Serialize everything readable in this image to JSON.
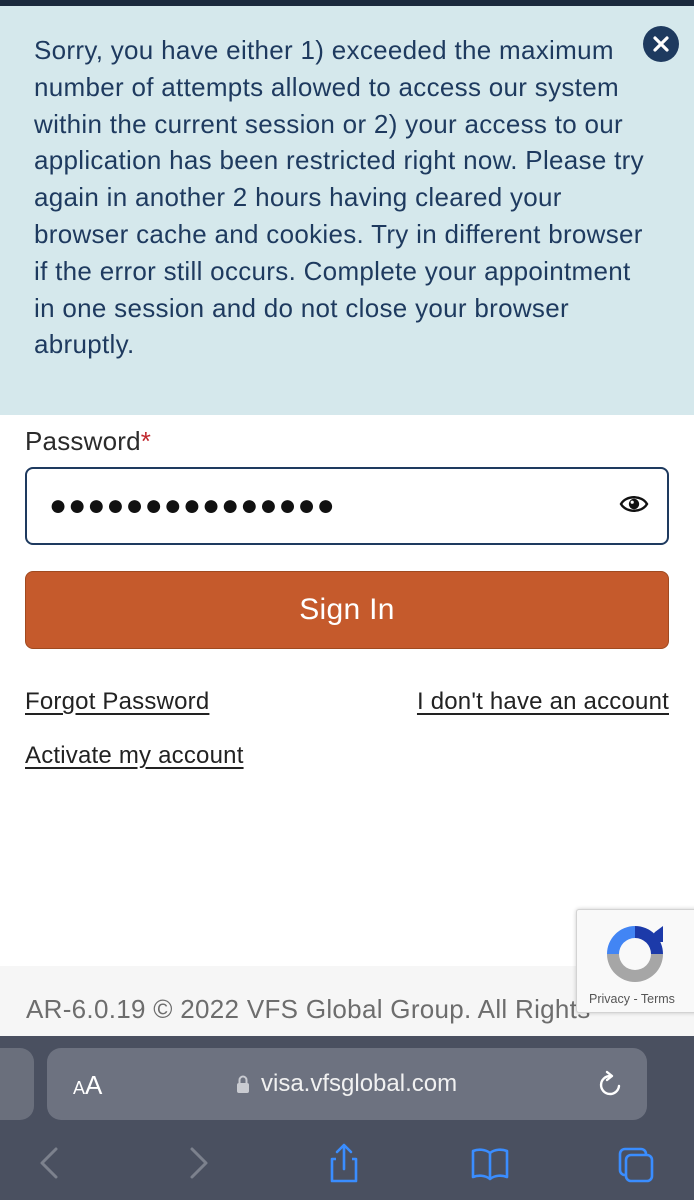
{
  "alert": {
    "message": "Sorry, you have either 1) exceeded the maximum number of attempts allowed to access our system within the current session or 2) your access to our application has been restricted right now. Please try again in another 2 hours having cleared your browser cache and cookies. Try in different browser if the error still occurs. Complete your appointment in one session and do not close your browser abruptly.",
    "close_icon": "close-circle-icon"
  },
  "form": {
    "password_label": "Password",
    "required_marker": "*",
    "password_value": "●●●●●●●●●●●●●●●",
    "show_password_icon": "eye-icon",
    "signin_label": "Sign In"
  },
  "links": {
    "forgot_password": "Forgot Password",
    "no_account": "I don't have an account",
    "activate_account": "Activate my account"
  },
  "footer": {
    "copyright": "AR-6.0.19 © 2022 VFS Global Group. All Rights"
  },
  "recaptcha": {
    "privacy": "Privacy",
    "separator": " - ",
    "terms": "Terms"
  },
  "browser": {
    "text_size_label_small": "A",
    "text_size_label_large": "A",
    "url": "visa.vfsglobal.com",
    "icons": [
      "lock-icon",
      "reload-icon",
      "back-icon",
      "forward-icon",
      "share-icon",
      "bookmarks-icon",
      "tabs-icon"
    ]
  },
  "colors": {
    "alert_background": "#d5e8ec",
    "alert_text": "#1e3a5f",
    "button_background": "#c55a2c",
    "input_border": "#1e3a5f",
    "required_star": "#c0272d",
    "browser_bar": "#4a5060"
  }
}
